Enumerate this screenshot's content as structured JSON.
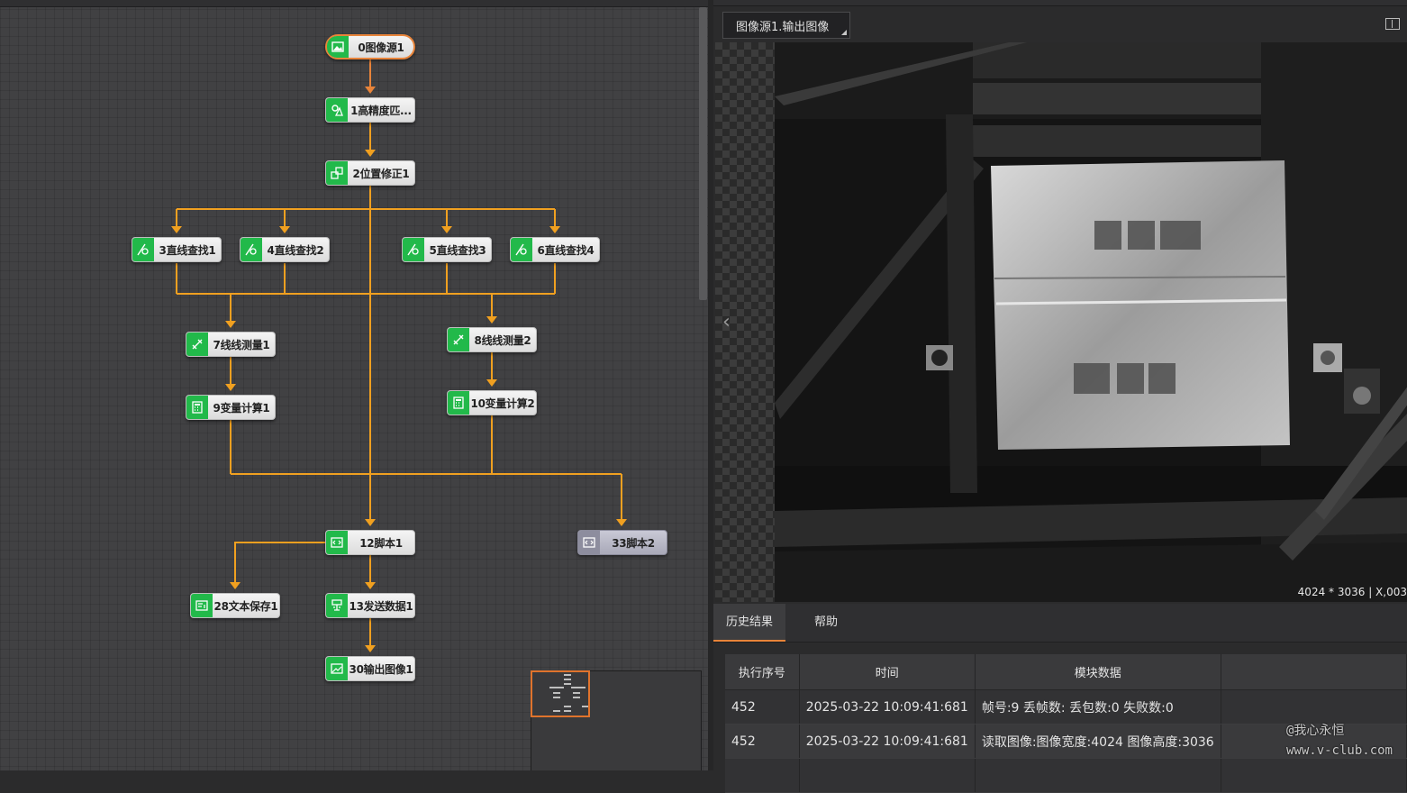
{
  "flow": {
    "nodes": {
      "n0": "0图像源1",
      "n1": "1高精度匹...",
      "n2": "2位置修正1",
      "n3": "3直线查找1",
      "n4": "4直线查找2",
      "n5": "5直线查找3",
      "n6": "6直线查找4",
      "n7": "7线线测量1",
      "n8": "8线线测量2",
      "n9": "9变量计算1",
      "n10": "10变量计算2",
      "n12": "12脚本1",
      "n33": "33脚本2",
      "n28": "28文本保存1",
      "n13": "13发送数据1",
      "n30": "30输出图像1"
    },
    "line_color": "#f0a020",
    "accent": "#e8843a",
    "node_icon_color": "#22b94a"
  },
  "viewer": {
    "tab_label": "图像源1.输出图像",
    "status_text": "4024 * 3036  |  X,003",
    "nav_prev": "‹"
  },
  "bottom": {
    "tabs": [
      "历史结果",
      "帮助"
    ],
    "columns": [
      "执行序号",
      "时间",
      "模块数据"
    ],
    "rows": [
      {
        "seq": "452",
        "time": "2025-03-22 10:09:41:681",
        "data": "帧号:9 丢帧数: 丢包数:0 失败数:0"
      },
      {
        "seq": "452",
        "time": "2025-03-22 10:09:41:681",
        "data": "读取图像:图像宽度:4024 图像高度:3036"
      }
    ]
  },
  "watermark": {
    "line1": "@我心永恒",
    "line2": "www.v-club.com"
  }
}
